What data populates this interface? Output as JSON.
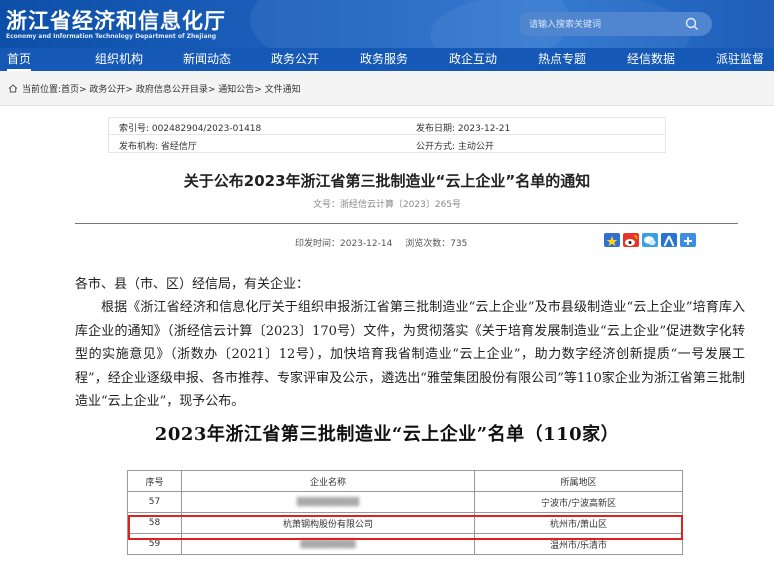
{
  "header": {
    "site_name": "浙江省经济和信息化厅",
    "site_name_en": "Economy and Information Technology Department of Zhejiang",
    "search_placeholder": "请输入搜索关键词"
  },
  "nav": {
    "items": [
      {
        "label": "首页"
      },
      {
        "label": "组织机构"
      },
      {
        "label": "新闻动态"
      },
      {
        "label": "政务公开"
      },
      {
        "label": "政务服务"
      },
      {
        "label": "政企互动"
      },
      {
        "label": "热点专题"
      },
      {
        "label": "经信数据"
      },
      {
        "label": "派驻监督"
      }
    ]
  },
  "breadcrumb": "当前位置:首页> 政务公开> 政府信息公开目录> 通知公告> 文件通知",
  "meta": {
    "index_no": "索引号: 002482904/2023-01418",
    "publish_date": "发布日期: 2023-12-21",
    "publisher": "发布机构: 省经信厅",
    "public_mode": "公开方式: 主动公开"
  },
  "article": {
    "title": "关于公布2023年浙江省第三批制造业“云上企业”名单的通知",
    "doc_no": "文号：浙经信云计算〔2023〕265号",
    "print_date": "印发时间：2023-12-14",
    "views": "浏览次数：735",
    "para1": "各市、县（市、区）经信局，有关企业：",
    "para2": "根据《浙江省经济和信息化厅关于组织申报浙江省第三批制造业“云上企业”及市县级制造业“云上企业”培育库入库企业的通知》（浙经信云计算〔2023〕170号）文件，为贯彻落实《关于培育发展制造业“云上企业”促进数字化转型的实施意见》（浙数办〔2021〕12号），加快培育我省制造业“云上企业”，助力数字经济创新提质“一号发展工程”，经企业逐级申报、各市推荐、专家评审及公示，遴选出“雅莹集团股份有限公司”等110家企业为浙江省第三批制造业“云上企业”，现予公布。"
  },
  "list_title": "2023年浙江省第三批制造业“云上企业”名单（110家）",
  "table": {
    "headers": [
      "序号",
      "企业名称",
      "所属地区"
    ],
    "rows": [
      {
        "no": "57",
        "name": "",
        "region": "宁波市/宁波高新区"
      },
      {
        "no": "58",
        "name": "杭萧钢构股份有限公司",
        "region": "杭州市/萧山区"
      },
      {
        "no": "59",
        "name": "",
        "region": "温州市/乐清市"
      }
    ]
  },
  "colors": {
    "header_blue": "#1558b5",
    "highlight_red": "#e02020"
  }
}
